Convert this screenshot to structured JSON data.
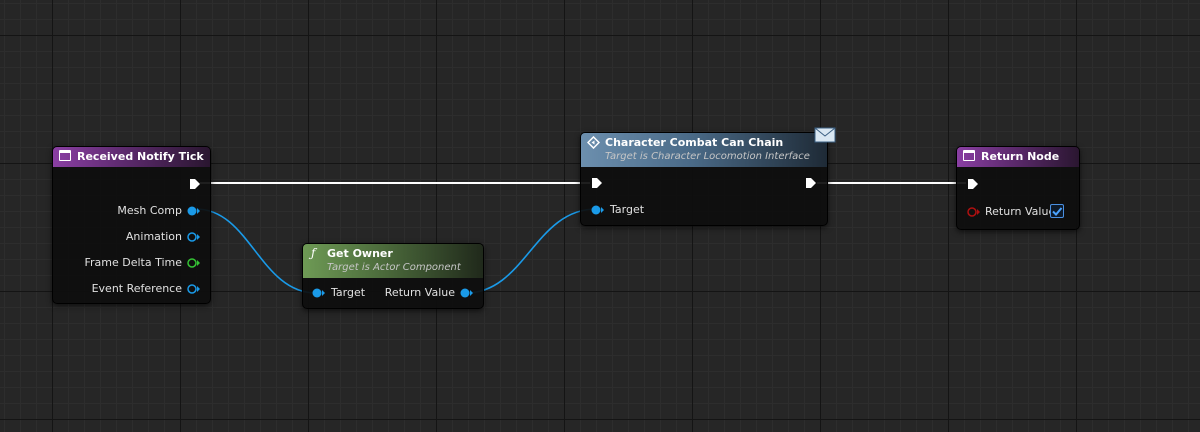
{
  "colors": {
    "exec_wire": "#ffffff",
    "object_pin": "#1a9ae8",
    "float_pin": "#35c435",
    "bool_pin": "#b01010",
    "event_header": "#8a3fa3",
    "pure_fn_header": "#6e9a55",
    "message_header": "#6c8fae"
  },
  "nodes": {
    "received_notify_tick": {
      "title": "Received Notify Tick",
      "icon": "event-icon",
      "outputs": [
        "Mesh Comp",
        "Animation",
        "Frame Delta Time",
        "Event Reference"
      ]
    },
    "get_owner": {
      "title": "Get Owner",
      "subtitle": "Target is Actor Component",
      "icon": "function-icon",
      "input": "Target",
      "output": "Return Value"
    },
    "character_combat_can_chain": {
      "title": "Character Combat Can Chain",
      "subtitle": "Target is Character Locomotion Interface",
      "icon": "interface-message-icon",
      "badge_icon": "envelope-icon",
      "input": "Target"
    },
    "return_node": {
      "title": "Return Node",
      "icon": "event-icon",
      "input": "Return Value",
      "return_value_checked": true
    }
  }
}
